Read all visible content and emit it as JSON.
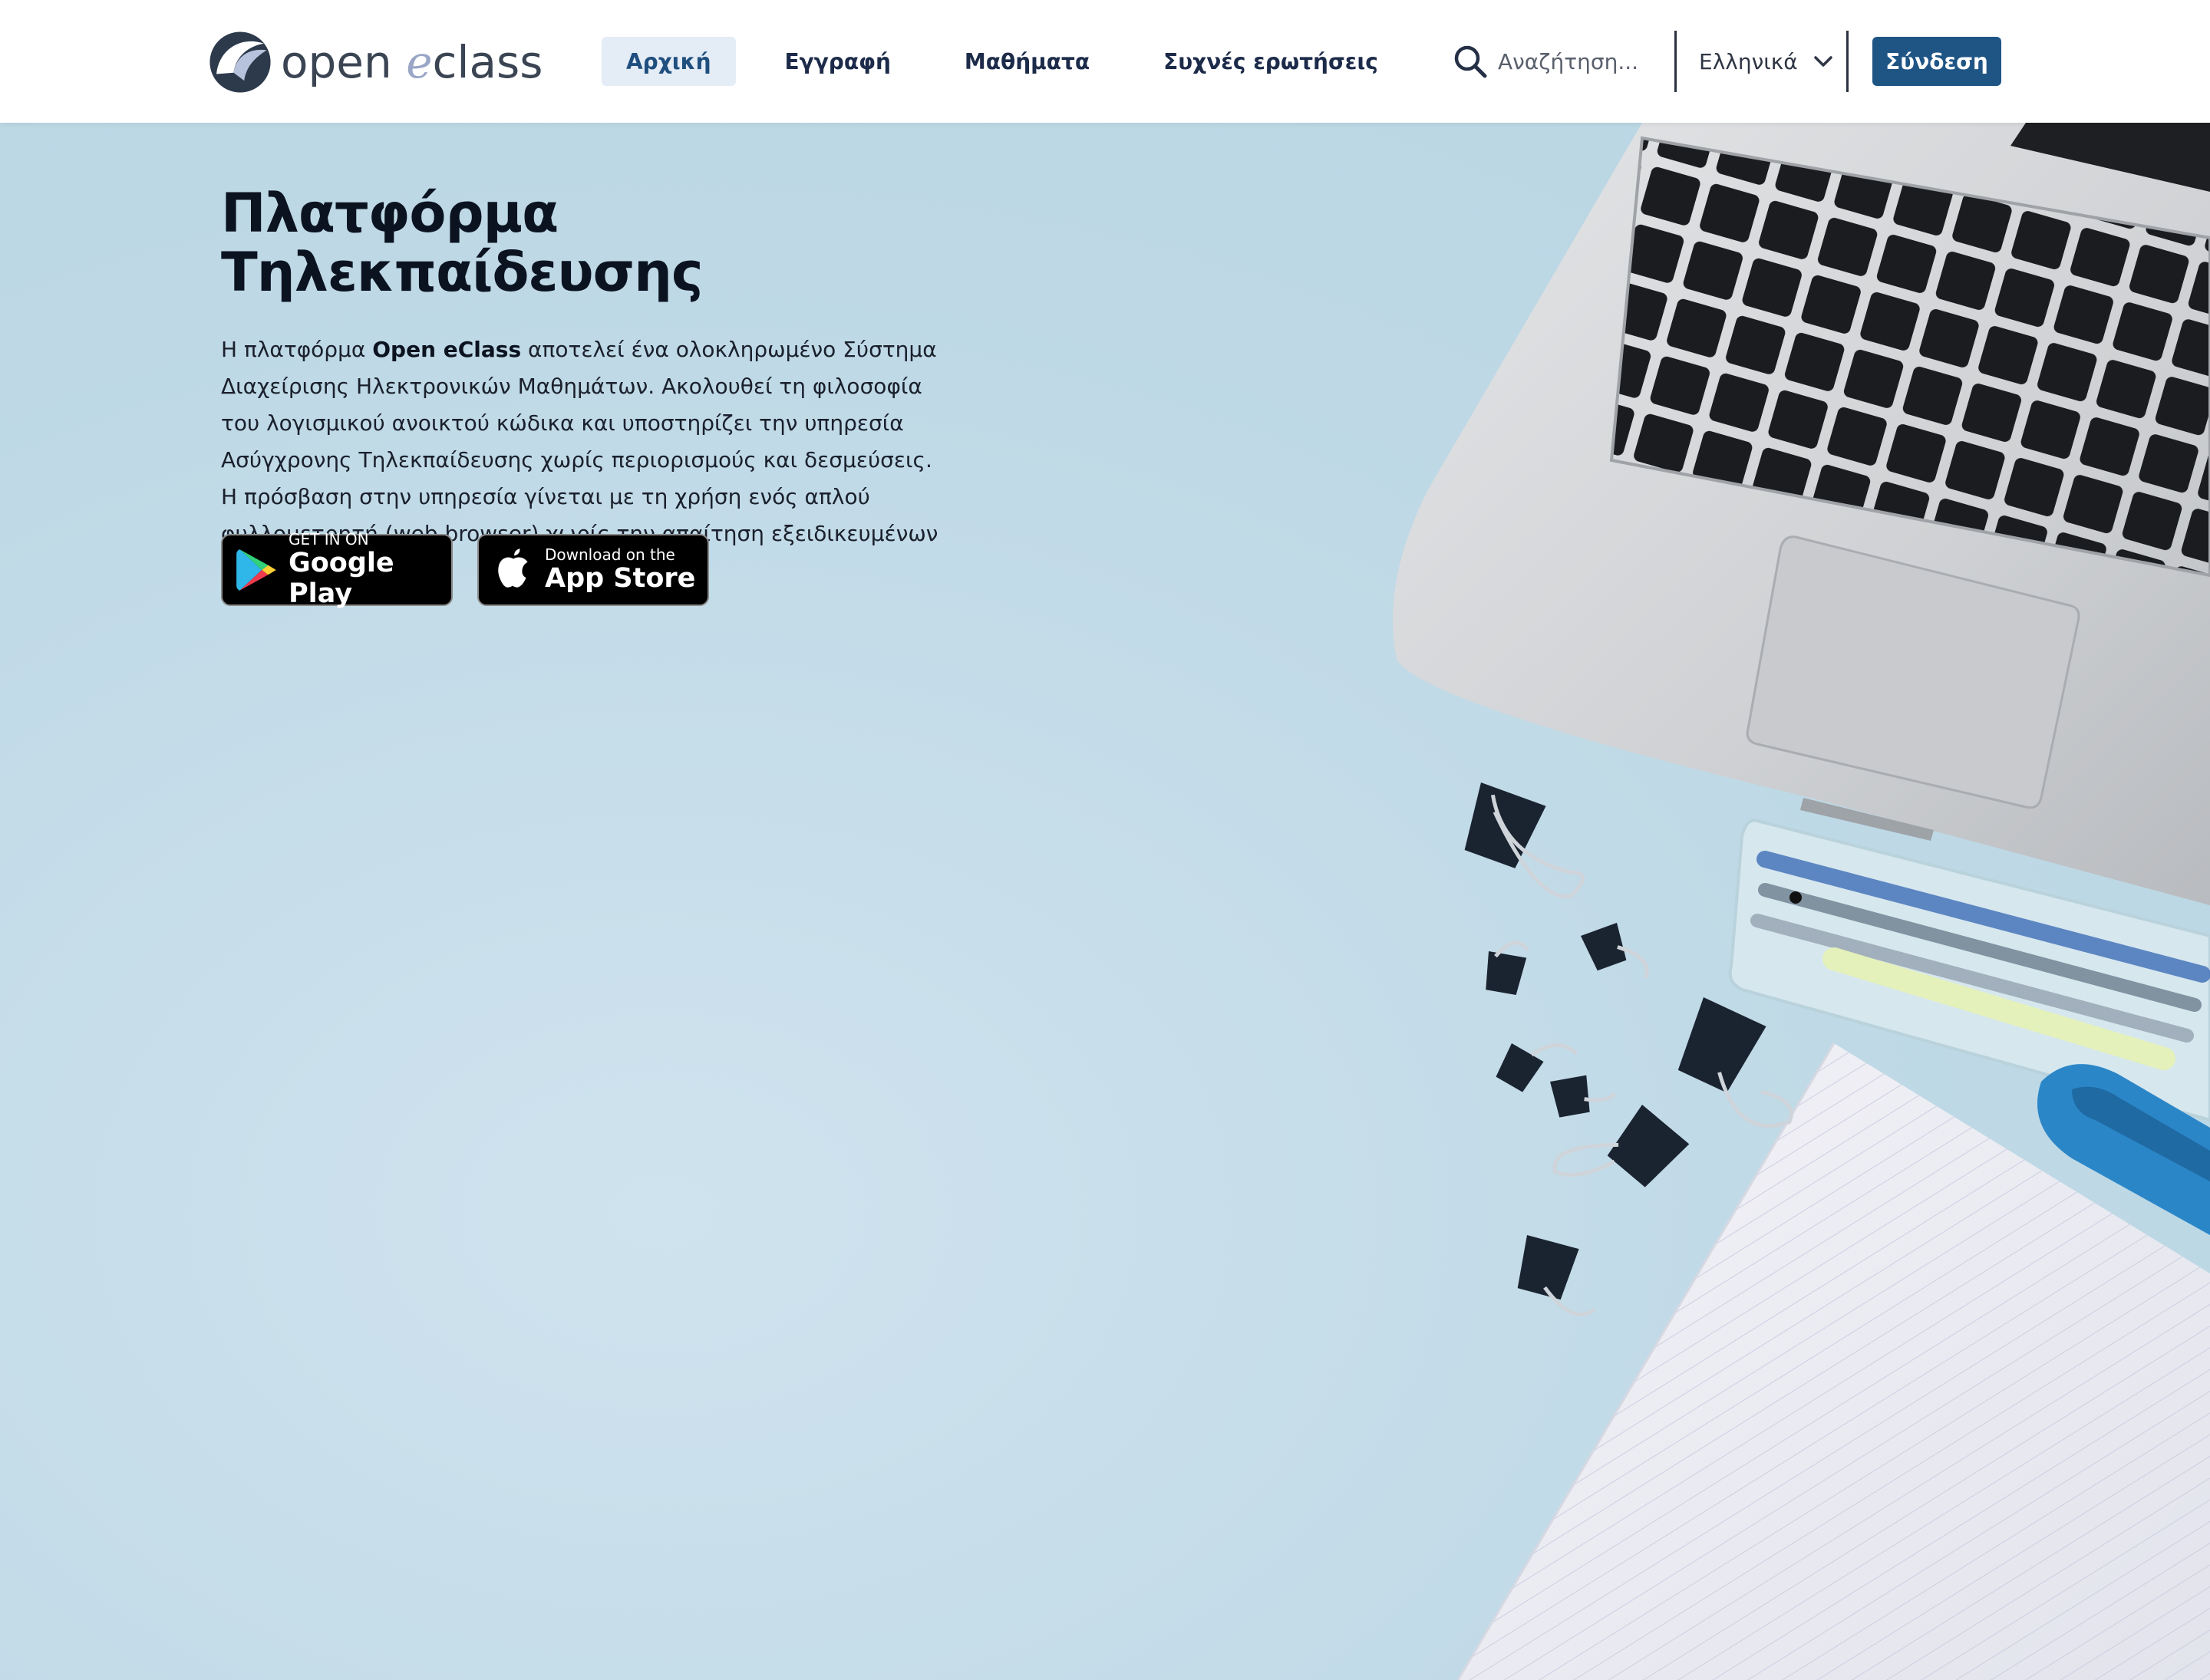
{
  "header": {
    "logo": {
      "word1": "open",
      "word2": "e",
      "word3": "class"
    },
    "nav": [
      {
        "label": "Αρχική",
        "active": true
      },
      {
        "label": "Εγγραφή",
        "active": false
      },
      {
        "label": "Μαθήματα",
        "active": false
      },
      {
        "label": "Συχνές ερωτήσεις",
        "active": false
      }
    ],
    "search": {
      "placeholder": "Αναζήτηση..."
    },
    "language": {
      "selected": "Ελληνικά"
    },
    "login_label": "Σύνδεση"
  },
  "hero": {
    "title": "Πλατφόρμα Τηλεκπαίδευσης",
    "description": {
      "before": "Η πλατφόρμα ",
      "bold": "Open eClass",
      "after": " αποτελεί ένα ολοκληρωμένο Σύστημα Διαχείρισης Ηλεκτρονικών Μαθημάτων. Ακολουθεί τη φιλοσοφία του λογισμικού ανοικτού κώδικα και υποστηρίζει την υπηρεσία Ασύγχρονης Τηλεκπαίδευσης χωρίς περιορισμούς και δεσμεύσεις. Η πρόσβαση στην υπηρεσία γίνεται με τη χρήση ενός απλού φυλλομετρητή (web browser) χωρίς την απαίτηση εξειδικευμένων τεχνικών γνώσεων."
    },
    "badges": {
      "google": {
        "small": "GET IN ON",
        "big": "Google Play"
      },
      "apple": {
        "small": "Download on the",
        "big": "App Store"
      }
    }
  },
  "colors": {
    "accent": "#1f5585",
    "active_nav_bg": "#e4ecf6",
    "hero_bg": "#c5dde8"
  },
  "icons": [
    "eclass-logo-icon",
    "search-icon",
    "chevron-down-icon",
    "google-play-icon",
    "apple-icon"
  ]
}
